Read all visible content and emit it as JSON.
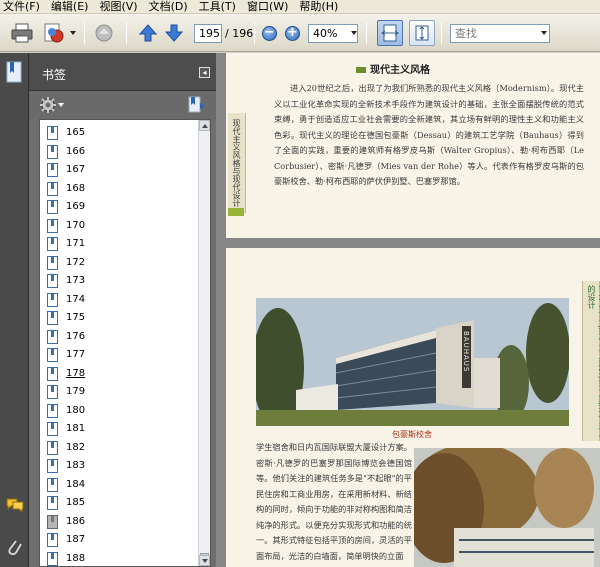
{
  "menu": [
    "文件(F)",
    "编辑(E)",
    "视图(V)",
    "文档(D)",
    "工具(T)",
    "窗口(W)",
    "帮助(H)"
  ],
  "toolbar": {
    "current_page": "195",
    "page_of": "/ 196",
    "zoom": "40%",
    "search_placeholder": "查找"
  },
  "panel": {
    "title": "书签",
    "collapse_glyph": "◂",
    "bookmarks": [
      "165",
      "166",
      "167",
      "168",
      "169",
      "170",
      "171",
      "172",
      "173",
      "174",
      "175",
      "176",
      "177",
      "178",
      "179",
      "180",
      "181",
      "182",
      "183",
      "184",
      "185",
      "186",
      "187",
      "188"
    ],
    "selected_bookmark": "186",
    "link_bookmark": "178"
  },
  "page1": {
    "section_title": "现代主义风格",
    "side_tab": "现代主义风格与现代设计",
    "paragraph": "进入20世纪之后，出现了为我们所熟悉的现代主义风格（Modernism）。现代主义以工业化革命实现的全新技术手段作为建筑设计的基础，主张全面摆脱传统的范式束缚，勇于创造适应工业社会需要的全新建筑，其立场有鲜明的理性主义和功能主义色彩。现代主义的理论在德国包豪斯（Dessau）的建筑工艺学院（Bauhaus）得到了全面的实践，重要的建筑师有格罗皮乌斯（Walter Gropius）、勒·柯布西耶（Le Corbusier）、密斯·凡德罗（Mies van der Rohe）等人。代表作有格罗皮乌斯的包豪斯校舍、勒·柯布西耶的萨伏伊别墅、巴塞罗那馆。"
  },
  "page2": {
    "photo_caption": "包豪斯校舍",
    "building_sign": "BAUHAUS",
    "side_tab": "艺术与设计|现代主义建筑|第十章|现代主义的设计",
    "paragraph": "学生宿舍和日内瓦国际联盟大厦设计方案。密斯·凡德罗的巴塞罗那国际博览会德国馆等。他们关注的建筑任务多是\"不起眼\"的平民住房和工商业用房，在采用新材料、新结构的同时，倾向于功能的非对称构图和简洁纯净的形式。以便充分实现形式和功能的统一。其形式特征包括平顶的房间，灵活的平面布局，光洁的白墙面，简单明快的立面"
  },
  "colors": {
    "panel_bg": "#6e6e6e",
    "doc_bg": "#868686",
    "accent_blue": "#3b6ea5"
  }
}
